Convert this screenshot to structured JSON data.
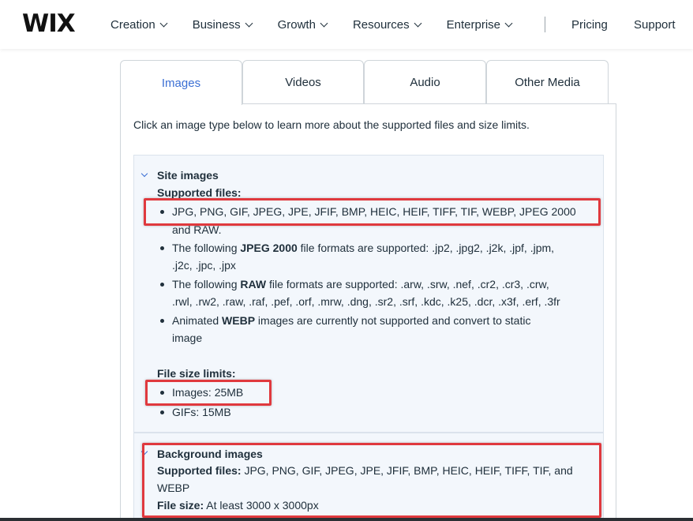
{
  "header": {
    "logo": "WIX",
    "nav": [
      "Creation",
      "Business",
      "Growth",
      "Resources",
      "Enterprise"
    ],
    "right_links": [
      "Pricing",
      "Support"
    ]
  },
  "tabs": [
    "Images",
    "Videos",
    "Audio",
    "Other Media"
  ],
  "active_tab": "Images",
  "intro": "Click an image type below to learn more about the supported files and size limits.",
  "site_images": {
    "title": "Site images",
    "supported_label": "Supported files:",
    "b1_l1": "JPG, PNG, GIF, JPEG, JPE, JFIF, BMP, HEIC, HEIF, TIFF, TIF, WEBP, JPEG 2000",
    "b1_l2": "and RAW.",
    "b2_pre": "The following ",
    "b2_bold": "JPEG 2000",
    "b2_post": " file formats are supported: .jp2, .jpg2, .j2k, .jpf, .jpm,",
    "b2_l2": ".j2c, .jpc, .jpx",
    "b3_pre": "The following ",
    "b3_bold": "RAW",
    "b3_post": " file formats are supported: .arw, .srw, .nef, .cr2, .cr3, .crw,",
    "b3_l2": ".rwl, .rw2, .raw, .raf, .pef, .orf, .mrw, .dng, .sr2, .srf, .kdc, .k25, .dcr, .x3f, .erf, .3fr",
    "b4_pre": "Animated ",
    "b4_bold": "WEBP",
    "b4_post": " images are currently not supported and convert to static",
    "b4_l2": "image",
    "limits_label": "File size limits:",
    "limit1": "Images: 25MB",
    "limit2": "GIFs: 15MB"
  },
  "background_images": {
    "title": "Background images",
    "supported_label": "Supported files:",
    "supported_l1": " JPG, PNG, GIF, JPEG, JPE, JFIF, BMP, HEIC, HEIF, TIFF, TIF, and",
    "supported_l2": "WEBP",
    "size_label": "File size:",
    "size_value": " At least 3000 x 3000px"
  },
  "colors": {
    "accent": "#3b6fd4",
    "highlight": "#e0393e",
    "section_bg": "#f3f7fc"
  }
}
